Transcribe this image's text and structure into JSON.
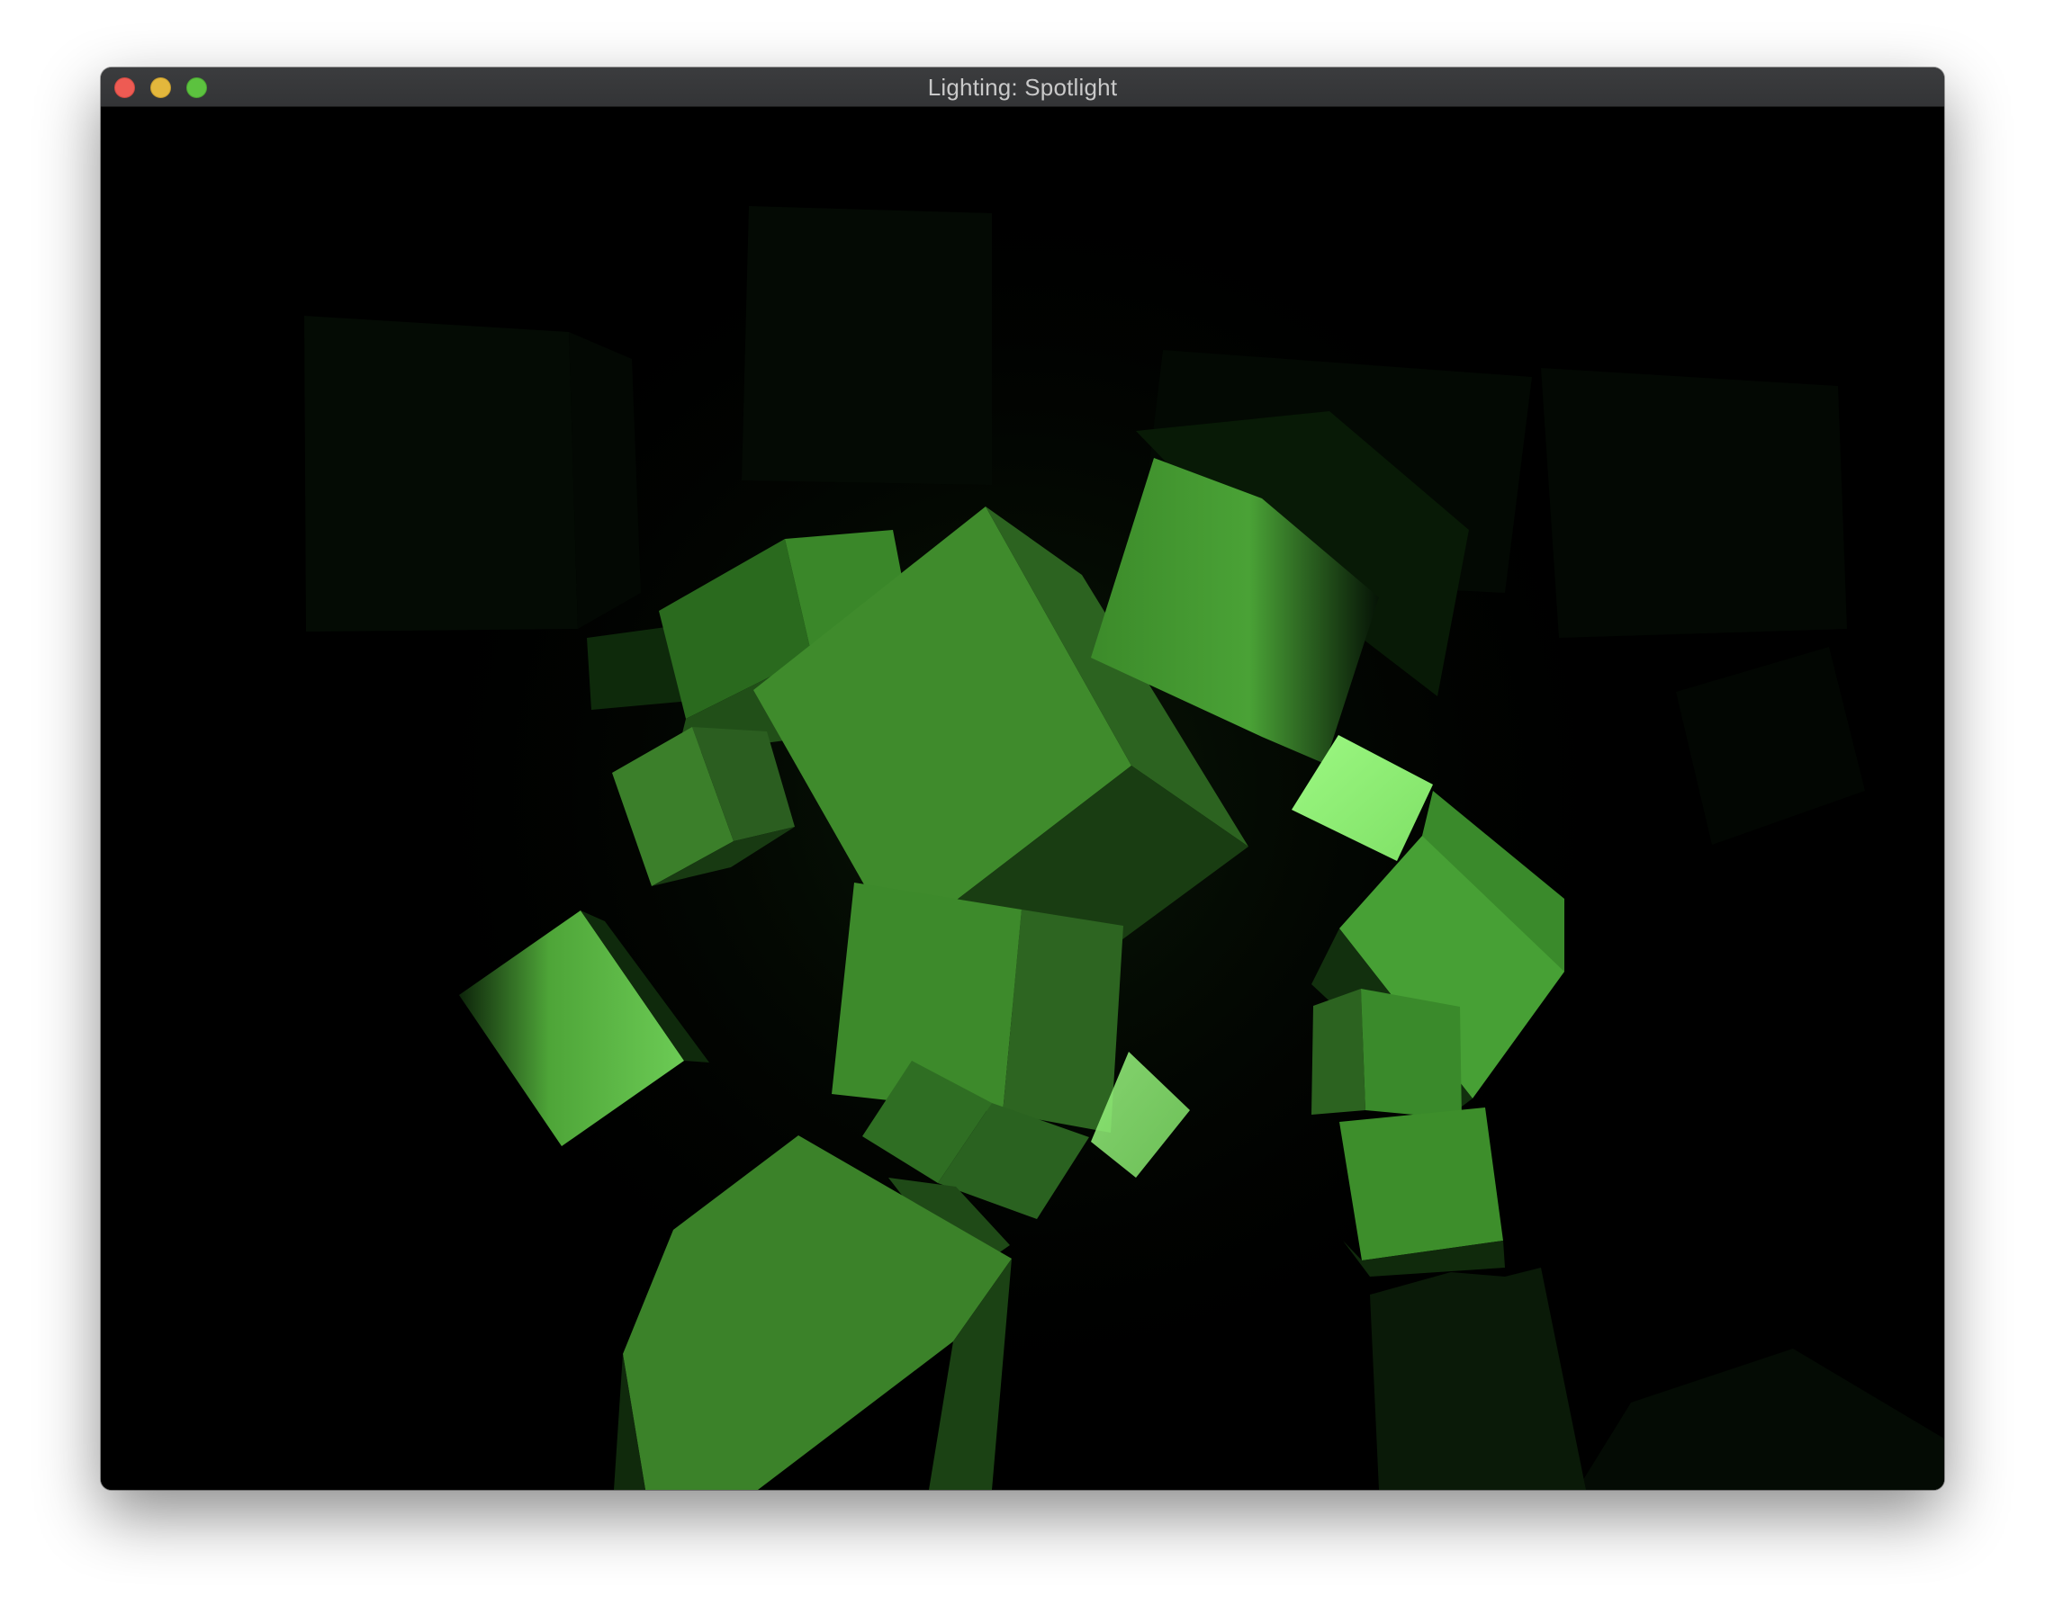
{
  "window": {
    "title": "Lighting: Spotlight"
  },
  "controls": {
    "close": "close",
    "minimize": "minimize",
    "zoom": "zoom"
  },
  "scene": {
    "background": "#000000",
    "object": "cube",
    "cube_color": "#43972f",
    "light": "spotlight"
  }
}
